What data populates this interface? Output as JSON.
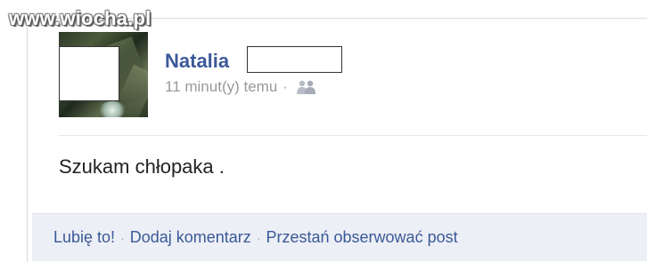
{
  "watermark": "www.wiocha.pl",
  "post": {
    "author": "Natalia",
    "timestamp": "11 minut(y) temu",
    "meta_separator": "·",
    "audience_icon": "friends-icon",
    "text": "Szukam chłopaka ."
  },
  "actions": {
    "like": "Lubię to!",
    "comment": "Dodaj komentarz",
    "unfollow": "Przestań obserwować post",
    "separator": "·"
  },
  "colors": {
    "link": "#3b5998",
    "meta": "#999999",
    "action_bar": "#eceff5"
  }
}
